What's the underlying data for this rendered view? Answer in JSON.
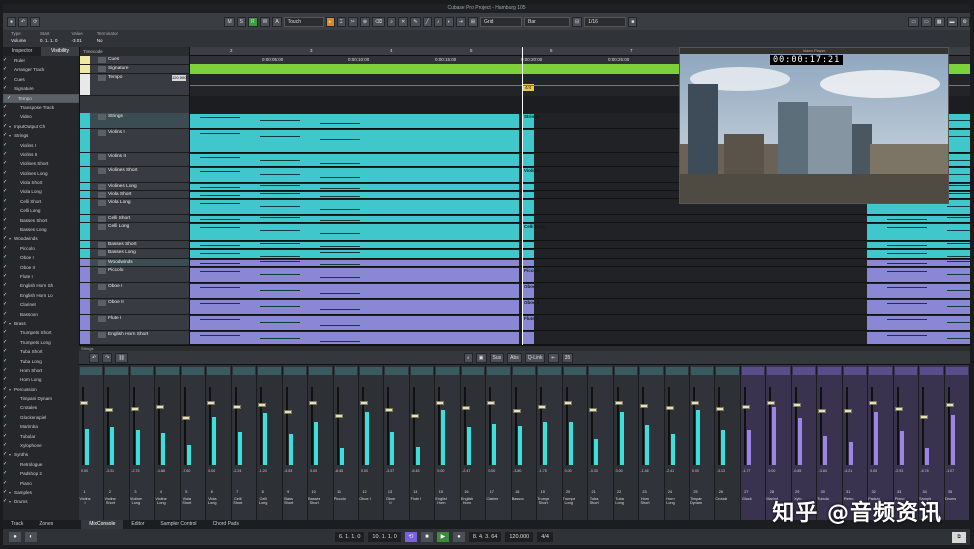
{
  "window": {
    "title": "Cubase Pro Project - Hamburg 105"
  },
  "toolbar": {
    "m": "M",
    "s": "S",
    "r": "R",
    "w": "W",
    "a": "A",
    "automation": "Touch",
    "snap": "Grid",
    "snap_type": "Bar",
    "quantize": "1/16"
  },
  "infoline": [
    {
      "label": "Type",
      "value": "Volume"
    },
    {
      "label": "Start",
      "value": "0. 1. 1. 0"
    },
    {
      "label": "Value",
      "value": "-3.01"
    },
    {
      "label": "Terminator",
      "value": "No"
    }
  ],
  "left_zone": {
    "tab_inspector": "Inspector",
    "tab_visibility": "Visibility",
    "tab_track": "Track",
    "tab_zones": "Zones",
    "items": [
      "Ruler",
      "Arranger Track",
      "Cues",
      "Signature",
      "Tempo",
      "Transpose Track",
      "Video",
      "InputOutput Ch",
      "Strings",
      "Violins I",
      "Violins II",
      "Violines Short",
      "Violines Long",
      "Viola Short",
      "Viola Long",
      "Celli Short",
      "Celli Long",
      "Basses Short",
      "Basses Long",
      "Woodwinds",
      "Piccolo",
      "Oboe I",
      "Oboe II",
      "Flute I",
      "English Horn Sh",
      "English Horn Lo",
      "Clarinet",
      "Bassoon",
      "Brass",
      "Trumpets Short",
      "Trumpets Long",
      "Tuba Short",
      "Tuba Long",
      "Horn Short",
      "Horn Long",
      "Percussion",
      "Timpani Dynam",
      "Crotales",
      "Glockenspiel",
      "Marimba",
      "Tubular",
      "Xylophone",
      "Synths",
      "Retrologue",
      "Padshop 2",
      "Piano",
      "Samples",
      "Drums"
    ]
  },
  "tracklist": {
    "header": "Timecode",
    "tracks": [
      "Cues",
      "Signature",
      "Tempo",
      "Strings",
      "Violins I",
      "Violins II",
      "Violines Short",
      "Violines Long",
      "Viola Short",
      "Viola Long",
      "Celli Short",
      "Celli Long",
      "Basses Short",
      "Basses Long",
      "Woodwinds",
      "Piccolo",
      "Oboe I",
      "Oboe II",
      "Flute I",
      "English Horn Short"
    ],
    "tempo_value": "120.000"
  },
  "ruler": {
    "ticks": [
      "2",
      "3",
      "4",
      "5",
      "6",
      "7",
      "8",
      "9",
      "10"
    ],
    "times": [
      "0:00:05:00",
      "0:00:10:00",
      "0:00:15:00",
      "0:00:20:00",
      "0:00:25:00"
    ]
  },
  "events": {
    "strings": "Strings",
    "violins_i": "Violins I",
    "celli_long": "Celli Long",
    "piccolo": "Piccolo",
    "oboe_i": "Oboe I",
    "oboe_ii": "Oboe II",
    "flute_i": "Flute I",
    "sig": "4/4"
  },
  "video": {
    "header": "Video Player",
    "timecode": "00:00:17:21"
  },
  "lower_zone": {
    "label": "Strings",
    "tool_sus": "Sus",
    "tool_abs": "Abs",
    "tool_qlink": "Q-Link",
    "count": "35"
  },
  "mixer": {
    "channels": [
      {
        "num": "1",
        "name": "Violins I",
        "val": "0.00"
      },
      {
        "num": "2",
        "name": "Violines Short",
        "val": "-3.31"
      },
      {
        "num": "3",
        "name": "Violines Long",
        "val": "-2.75"
      },
      {
        "num": "4",
        "name": "Violines Long",
        "val": "-1.86"
      },
      {
        "num": "5",
        "name": "Viola Short",
        "val": "-7.60"
      },
      {
        "num": "6",
        "name": "Viola Long",
        "val": "0.00"
      },
      {
        "num": "7",
        "name": "Celli Short",
        "val": "-2.24"
      },
      {
        "num": "8",
        "name": "Celli Long",
        "val": "-1.20"
      },
      {
        "num": "9",
        "name": "Bass Short",
        "val": "-4.53"
      },
      {
        "num": "10",
        "name": "Basses Short",
        "val": "0.00"
      },
      {
        "num": "11",
        "name": "Piccolo",
        "val": "-6.45"
      },
      {
        "num": "12",
        "name": "Oboe I",
        "val": "0.00"
      },
      {
        "num": "13",
        "name": "Oboe II",
        "val": "-3.37"
      },
      {
        "num": "14",
        "name": "Flute I",
        "val": "-6.45"
      },
      {
        "num": "15",
        "name": "English Horn",
        "val": "0.00"
      },
      {
        "num": "16",
        "name": "English Horn",
        "val": "-2.47"
      },
      {
        "num": "17",
        "name": "Clarinet",
        "val": "0.00"
      },
      {
        "num": "18",
        "name": "Bassoon",
        "val": "-3.80"
      },
      {
        "num": "19",
        "name": "Trumpets Short",
        "val": "-1.75"
      },
      {
        "num": "20",
        "name": "Trumpets Long",
        "val": "0.00"
      },
      {
        "num": "21",
        "name": "Tuba Short",
        "val": "-3.33"
      },
      {
        "num": "22",
        "name": "Tuba Long",
        "val": "0.00"
      },
      {
        "num": "23",
        "name": "Horn Short",
        "val": "-1.48"
      },
      {
        "num": "24",
        "name": "Horn Long",
        "val": "-2.41"
      },
      {
        "num": "25",
        "name": "Timpani Dynamic",
        "val": "0.00"
      },
      {
        "num": "26",
        "name": "Crotales",
        "val": "-3.13"
      },
      {
        "num": "27",
        "name": "Glock",
        "val": "-1.77"
      },
      {
        "num": "28",
        "name": "Marimba",
        "val": "0.00"
      },
      {
        "num": "29",
        "name": "Xylo",
        "val": "-0.85"
      },
      {
        "num": "30",
        "name": "Tubular",
        "val": "-3.84"
      },
      {
        "num": "31",
        "name": "Retro",
        "val": "-4.21"
      },
      {
        "num": "32",
        "name": "Padshop",
        "val": "0.00"
      },
      {
        "num": "33",
        "name": "Piano",
        "val": "-2.93"
      },
      {
        "num": "34",
        "name": "Samples",
        "val": "-6.78"
      },
      {
        "num": "35",
        "name": "Drums",
        "val": "-1.07"
      }
    ]
  },
  "bottom_tabs": [
    "MixConsole",
    "Editor",
    "Sampler Control",
    "Chord Pads"
  ],
  "transport": {
    "left_locator": "6. 1. 1. 0",
    "right_locator": "10. 1. 1. 0",
    "position": "8. 4. 3. 64",
    "tempo": "120.000",
    "signature": "4/4"
  },
  "watermark": "知乎 @音频资讯"
}
